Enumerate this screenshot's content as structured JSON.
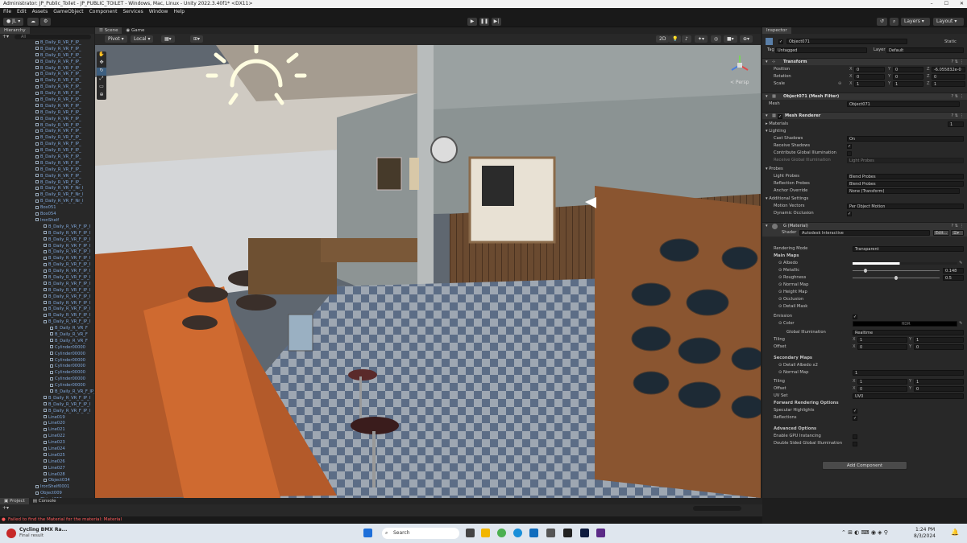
{
  "window": {
    "title": "Administrator: JP_Public_Toilet - JP_PUBLIC_TOILET - Windows, Mac, Linux - Unity 2022.3.40f1* <DX11>"
  },
  "menu": [
    "File",
    "Edit",
    "Assets",
    "GameObject",
    "Component",
    "Services",
    "Window",
    "Help"
  ],
  "toolbar": {
    "account": "JL",
    "layers": "Layers",
    "layout": "Layout"
  },
  "hierarchy": {
    "tab": "Hierarchy",
    "search_placeholder": "All",
    "items": [
      "B_Daily_R_VR_F_IP_",
      "B_Daily_R_VR_F_IP_",
      "B_Daily_R_VR_F_IP_",
      "B_Daily_R_VR_F_IP_",
      "B_Daily_R_VR_F_IP_",
      "B_Daily_R_VR_F_IP_",
      "B_Daily_R_VR_F_IP_",
      "B_Daily_R_VR_F_IP_",
      "B_Daily_R_VR_F_IP_",
      "B_Daily_R_VR_F_IP_",
      "B_Daily_R_VR_F_IP_",
      "B_Daily_R_VR_F_IP_",
      "B_Daily_R_VR_F_IP_",
      "B_Daily_R_VR_F_IP_",
      "B_Daily_R_VR_F_IP_",
      "B_Daily_R_VR_F_IP_",
      "B_Daily_R_VR_F_IP_",
      "B_Daily_R_VR_F_IP_",
      "B_Daily_R_VR_F_IP_",
      "B_Daily_R_VR_F_IP_",
      "B_Daily_R_VR_F_IP_",
      "B_Daily_R_VR_F_IP_",
      "B_Daily_R_VR_F_IP_",
      "B_Daily_R_VR_F_Nr_I",
      "B_Daily_R_VR_F_Nr_I",
      "B_Daily_R_VR_F_Nr_I",
      "Box051",
      "Box054",
      "IronShelf",
      "B_Daily_R_VR_F_IP_I",
      "B_Daily_R_VR_F_IP_I",
      "B_Daily_R_VR_F_IP_I",
      "B_Daily_R_VR_F_IP_I",
      "B_Daily_R_VR_F_IP_I",
      "B_Daily_R_VR_F_IP_I",
      "B_Daily_R_VR_F_IP_I",
      "B_Daily_R_VR_F_IP_I",
      "B_Daily_R_VR_F_IP_I",
      "B_Daily_R_VR_F_IP_I",
      "B_Daily_R_VR_F_IP_I",
      "B_Daily_R_VR_F_IP_I",
      "B_Daily_R_VR_F_IP_I",
      "B_Daily_R_VR_F_IP_I",
      "B_Daily_R_VR_F_IP_I",
      "B_Daily_R_VR_F_IP_I",
      "B_Daily_R_VR_F",
      "B_Daily_R_VR_F",
      "B_Daily_R_VR_F",
      "Cylinder00000",
      "Cylinder00000",
      "Cylinder00000",
      "Cylinder00000",
      "Cylinder00000",
      "Cylinder00000",
      "Cylinder00000",
      "B_Daily_R_VR_F_IP_I",
      "B_Daily_R_VR_F_IP_I",
      "B_Daily_R_VR_F_IP_I",
      "B_Daily_R_VR_F_IP_I",
      "Line019",
      "Line020",
      "Line021",
      "Line022",
      "Line023",
      "Line024",
      "Line025",
      "Line026",
      "Line027",
      "Line028",
      "Object034",
      "IronShelf0001",
      "Object009",
      "Object018",
      "Object071"
    ],
    "selected_index": 74
  },
  "scene": {
    "tab_scene": "Scene",
    "tab_game": "Game",
    "pivot": "Pivot",
    "local": "Local",
    "gizmo_label": "< Persp",
    "mode_2d": "2D",
    "shading": "20"
  },
  "inspector": {
    "tab": "Inspector",
    "object_name": "Object071",
    "static_label": "Static",
    "tag_label": "Tag",
    "tag_value": "Untagged",
    "layer_label": "Layer",
    "layer_value": "Default",
    "transform": {
      "title": "Transform",
      "position": {
        "label": "Position",
        "x": "0",
        "y": "0",
        "z": "-6.055832e-0"
      },
      "rotation": {
        "label": "Rotation",
        "x": "0",
        "y": "0",
        "z": "0"
      },
      "scale": {
        "label": "Scale",
        "x": "1",
        "y": "1",
        "z": "1"
      }
    },
    "mesh_filter": {
      "title": "Object071 (Mesh Filter)",
      "mesh_label": "Mesh",
      "mesh_value": "Object071"
    },
    "mesh_renderer": {
      "title": "Mesh Renderer",
      "materials_label": "Materials",
      "materials_count": "1",
      "lighting_label": "Lighting",
      "cast_shadows_label": "Cast Shadows",
      "cast_shadows_value": "On",
      "receive_shadows_label": "Receive Shadows",
      "contribute_gi_label": "Contribute Global Illumination",
      "receive_gi_label": "Receive Global Illumination",
      "receive_gi_value": "Light Probes",
      "probes_label": "Probes",
      "light_probes_label": "Light Probes",
      "light_probes_value": "Blend Probes",
      "reflection_probes_label": "Reflection Probes",
      "reflection_probes_value": "Blend Probes",
      "anchor_override_label": "Anchor Override",
      "anchor_override_value": "None (Transform)",
      "additional_label": "Additional Settings",
      "motion_vectors_label": "Motion Vectors",
      "motion_vectors_value": "Per Object Motion",
      "dynamic_occlusion_label": "Dynamic Occlusion"
    },
    "material": {
      "title": "G (Material)",
      "shader_label": "Shader",
      "shader_value": "Autodesk Interactive",
      "edit_label": "Edit...",
      "rendering_mode_label": "Rendering Mode",
      "rendering_mode_value": "Transparent",
      "main_maps_label": "Main Maps",
      "albedo_label": "Albedo",
      "metallic_label": "Metallic",
      "metallic_value": "0.148",
      "metallic_level": 0.148,
      "roughness_label": "Roughness",
      "roughness_value": "0.5",
      "roughness_level": 0.5,
      "normal_map_label": "Normal Map",
      "height_map_label": "Height Map",
      "occlusion_label": "Occlusion",
      "detail_mask_label": "Detail Mask",
      "emission_label": "Emission",
      "color_label": "Color",
      "hdr_label": "HDR",
      "global_illum_label": "Global Illumination",
      "global_illum_value": "Realtime",
      "tiling_label": "Tiling",
      "tiling_x": "1",
      "tiling_y": "1",
      "offset_label": "Offset",
      "offset_x": "0",
      "offset_y": "0",
      "secondary_maps_label": "Secondary Maps",
      "detail_albedo_label": "Detail Albedo x2",
      "normal_map2_label": "Normal Map",
      "normal_map2_value": "1",
      "tiling2_label": "Tiling",
      "tiling2_x": "1",
      "tiling2_y": "1",
      "offset2_label": "Offset",
      "offset2_x": "0",
      "offset2_y": "0",
      "uv_set_label": "UV Set",
      "uv_set_value": "UV0",
      "forward_label": "Forward Rendering Options",
      "specular_label": "Specular Highlights",
      "reflections_label": "Reflections",
      "advanced_label": "Advanced Options",
      "gpu_instancing_label": "Enable GPU Instancing",
      "double_sided_label": "Double Sided Global Illumination"
    },
    "add_component": "Add Component"
  },
  "bottom": {
    "tab_project": "Project",
    "tab_console": "Console",
    "search_placeholder": ""
  },
  "status": {
    "message": "Failed to find the Material for the material: Material"
  },
  "taskbar": {
    "notification_title": "Cycling BMX Ra...",
    "notification_sub": "Final result",
    "search": "Search",
    "time": "1:24 PM",
    "date": "8/3/2024"
  },
  "colors": {
    "accent": "#2c5d87",
    "hierarchy_text": "#7fa6d9",
    "error": "#ff5a5a"
  }
}
